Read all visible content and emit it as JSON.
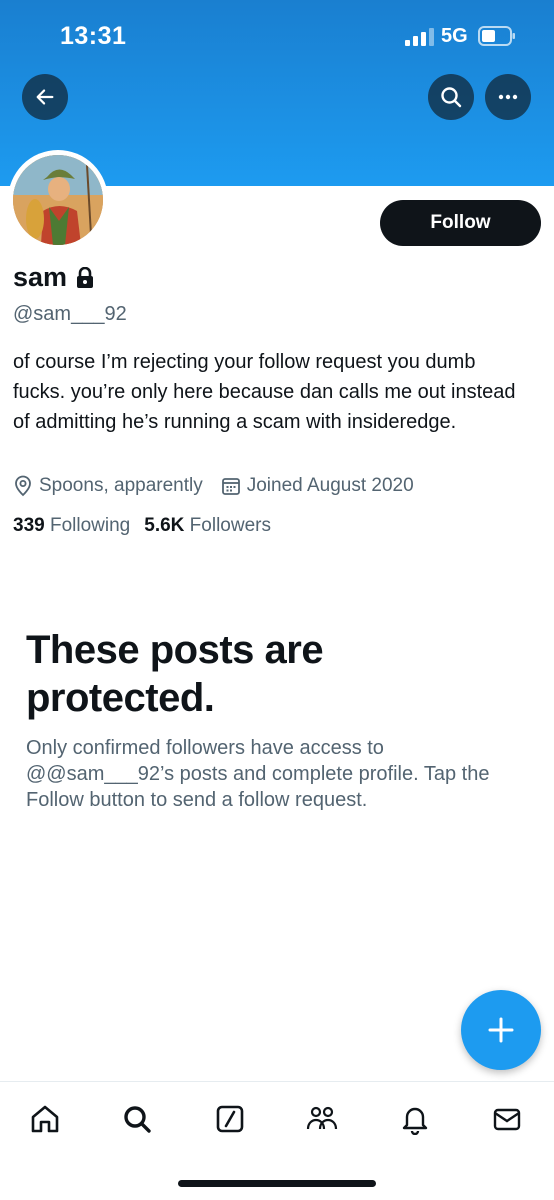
{
  "status_bar": {
    "time": "13:31",
    "network": "5G"
  },
  "profile": {
    "name": "sam",
    "handle": "@sam___92",
    "bio": "of course I’m rejecting your follow request you dumb fucks. you’re only here because dan calls me out instead of admitting he’s running a scam with insideredge.",
    "location": "Spoons, apparently",
    "joined": "Joined August 2020",
    "following_count": "339",
    "following_label": "Following",
    "followers_count": "5.6K",
    "followers_label": "Followers",
    "follow_label": "Follow"
  },
  "protected_notice": {
    "title": "These posts are protected.",
    "body": "Only confirmed followers have access to @@sam___92’s posts and complete profile. Tap the Follow button to send a follow request."
  },
  "icons": {
    "back": "arrow-left-icon",
    "search": "search-icon",
    "more": "more-icon",
    "lock": "lock-icon",
    "location": "location-pin-icon",
    "calendar": "calendar-icon",
    "compose": "plus-icon",
    "tabs": [
      "home-icon",
      "search-icon",
      "grok-icon",
      "communities-icon",
      "bell-icon",
      "mail-icon"
    ]
  },
  "colors": {
    "accent": "#1d9bf0",
    "text": "#0f1419",
    "secondary_text": "#536471"
  }
}
